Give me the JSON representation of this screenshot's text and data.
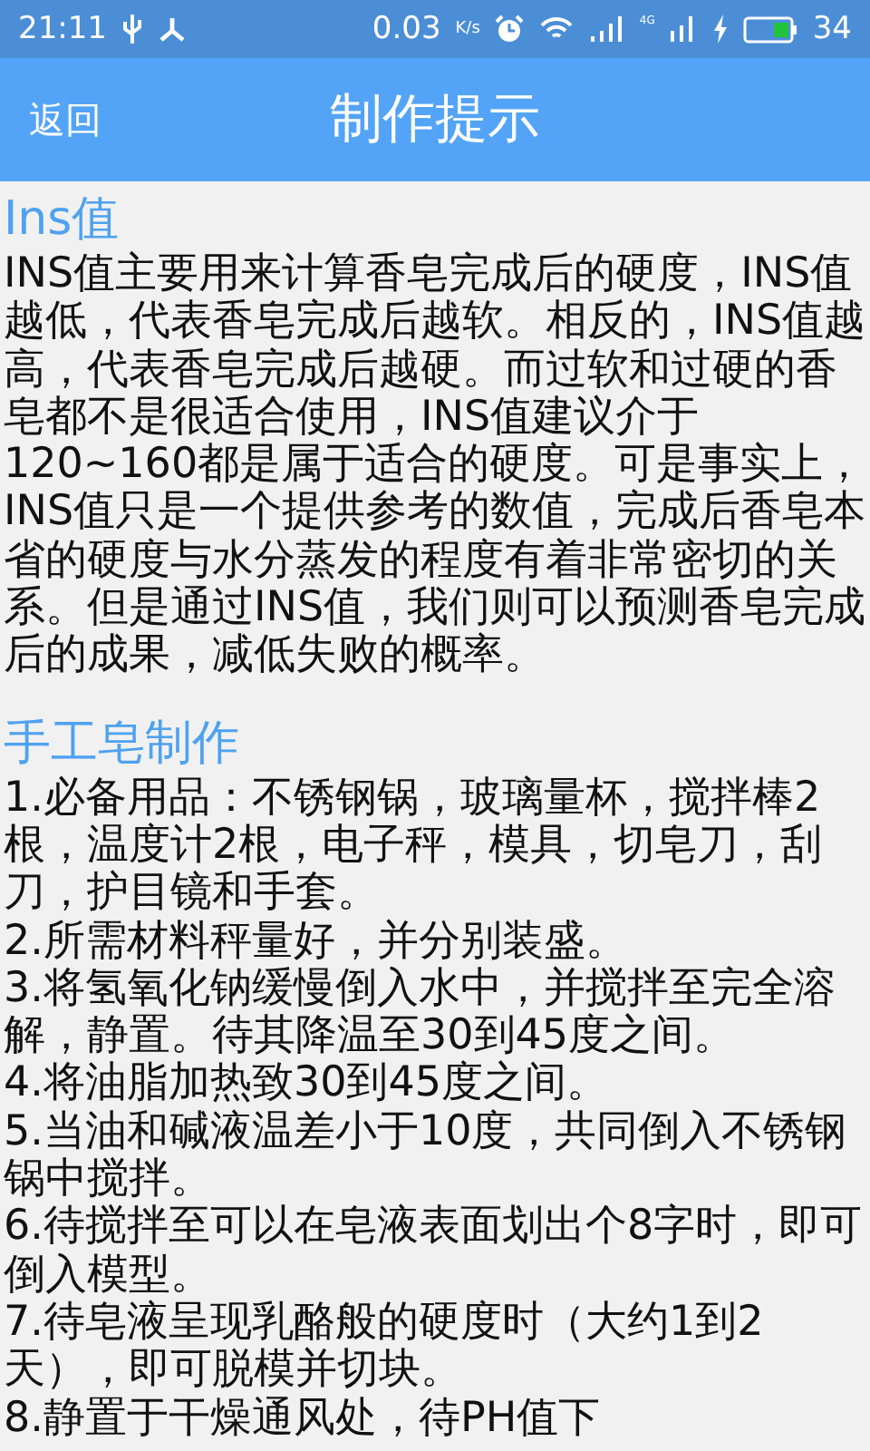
{
  "status_bar": {
    "time": "21:11",
    "speed": "0.03",
    "speed_unit": "K/s",
    "network": "4G",
    "battery": "34"
  },
  "app_bar": {
    "back": "返回",
    "title": "制作提示"
  },
  "sections": [
    {
      "heading": "Ins值",
      "kind": "paragraph",
      "text": "INS值主要用来计算香皂完成后的硬度，INS值越低，代表香皂完成后越软。相反的，INS值越高，代表香皂完成后越硬。而过软和过硬的香皂都不是很适合使用，INS值建议介于120~160都是属于适合的硬度。可是事实上，INS值只是一个提供参考的数值，完成后香皂本省的硬度与水分蒸发的程度有着非常密切的关系。但是通过INS值，我们则可以预测香皂完成后的成果，减低失败的概率。"
    },
    {
      "heading": "手工皂制作",
      "kind": "steps",
      "items": [
        "1.必备用品：不锈钢锅，玻璃量杯，搅拌棒2根，温度计2根，电子秤，模具，切皂刀，刮刀，护目镜和手套。",
        "2.所需材料秤量好，并分别装盛。",
        "3.将氢氧化钠缓慢倒入水中，并搅拌至完全溶解，静置。待其降温至30到45度之间。",
        "4.将油脂加热致30到45度之间。",
        "5.当油和碱液温差小于10度，共同倒入不锈钢锅中搅拌。",
        "6.待搅拌至可以在皂液表面划出个8字时，即可倒入模型。",
        "7.待皂液呈现乳酪般的硬度时（大约1到2天），即可脱模并切块。",
        "8.静置于干燥通风处，待PH值下"
      ]
    }
  ]
}
